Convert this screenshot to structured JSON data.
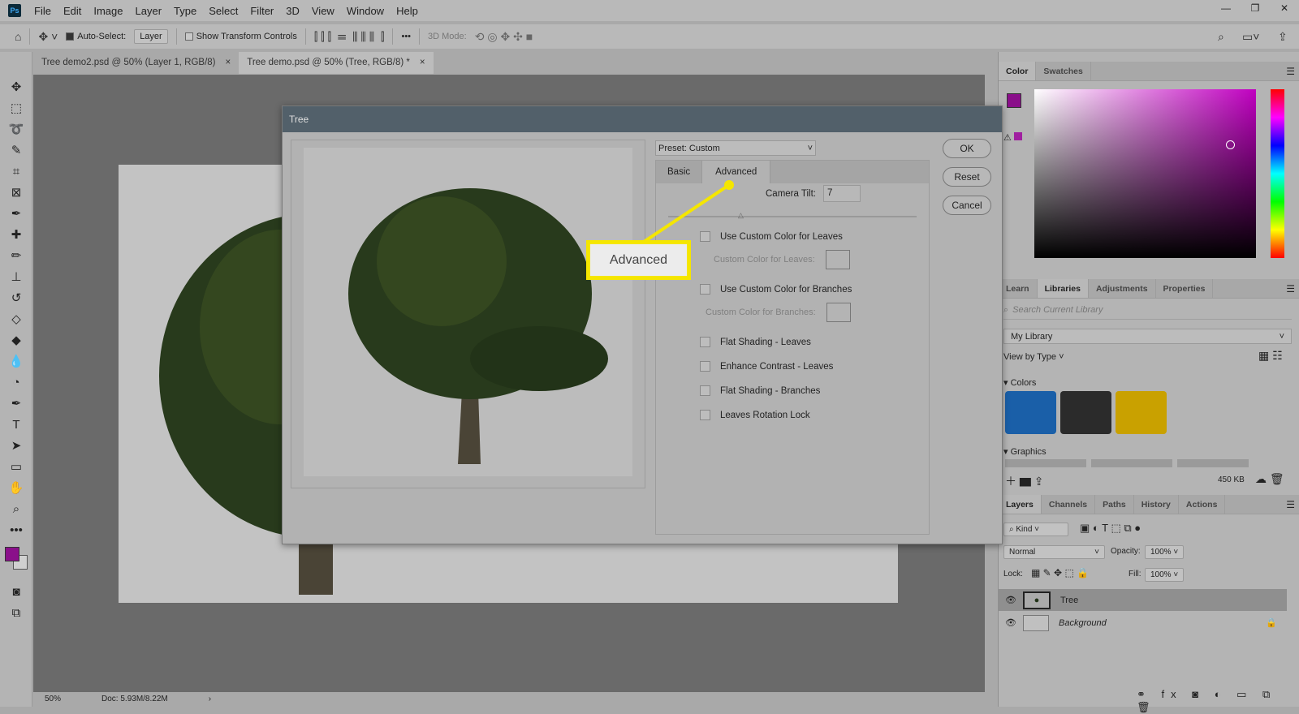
{
  "app": {
    "logo": "Ps",
    "menu": [
      "File",
      "Edit",
      "Image",
      "Layer",
      "Type",
      "Select",
      "Filter",
      "3D",
      "View",
      "Window",
      "Help"
    ],
    "window_controls": [
      "minimize",
      "restore",
      "close"
    ]
  },
  "options": {
    "auto_select_label": "Auto-Select:",
    "auto_select_checked": true,
    "layer_select": "Layer",
    "show_transform_label": "Show Transform Controls",
    "mode_3d_label": "3D Mode:",
    "more": "•••"
  },
  "documents": [
    {
      "title": "Tree demo2.psd @ 50% (Layer 1, RGB/8)",
      "active": false
    },
    {
      "title": "Tree demo.psd @ 50% (Tree, RGB/8) *",
      "active": true
    }
  ],
  "status": {
    "zoom": "50%",
    "doc": "Doc: 5.93M/8.22M"
  },
  "dialog": {
    "title": "Tree",
    "preset": "Preset: Custom",
    "tabs": [
      "Basic",
      "Advanced"
    ],
    "active_tab": "Advanced",
    "camera_tilt_label": "Camera Tilt:",
    "camera_tilt_value": "7",
    "options": [
      {
        "label": "Use Custom Color for Leaves",
        "checked": false
      },
      {
        "label": "Use Custom Color for Branches",
        "checked": false
      },
      {
        "label": "Flat Shading - Leaves",
        "checked": false
      },
      {
        "label": "Enhance Contrast - Leaves",
        "checked": false
      },
      {
        "label": "Flat Shading - Branches",
        "checked": false
      },
      {
        "label": "Leaves Rotation Lock",
        "checked": false
      }
    ],
    "custom_leaves_label": "Custom Color for Leaves:",
    "custom_branches_label": "Custom Color for Branches:",
    "buttons": {
      "ok": "OK",
      "reset": "Reset",
      "cancel": "Cancel"
    }
  },
  "callout": {
    "text": "Advanced",
    "color": "#f5e600"
  },
  "color_panel": {
    "tabs": [
      "Color",
      "Swatches"
    ],
    "foreground": "#8a0f8a",
    "hue_color": "#c000c0"
  },
  "libraries_panel": {
    "tabs": [
      "Learn",
      "Libraries",
      "Adjustments",
      "Properties"
    ],
    "active": "Libraries",
    "search_placeholder": "Search Current Library",
    "library": "My Library",
    "view_by": "View by Type",
    "colors_label": "Colors",
    "colors": [
      "#1a5fa8",
      "#2b2b2b",
      "#c9a100"
    ],
    "graphics_label": "Graphics",
    "size": "450 KB"
  },
  "layers_panel": {
    "tabs": [
      "Layers",
      "Channels",
      "Paths",
      "History",
      "Actions"
    ],
    "active": "Layers",
    "filter": "Kind",
    "blend": "Normal",
    "opacity_label": "Opacity:",
    "opacity": "100%",
    "lock_label": "Lock:",
    "fill_label": "Fill:",
    "fill": "100%",
    "layers": [
      {
        "name": "Tree",
        "visible": true,
        "selected": true
      },
      {
        "name": "Background",
        "visible": true,
        "locked": true
      }
    ]
  }
}
